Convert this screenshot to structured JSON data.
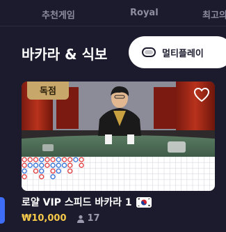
{
  "nav": {
    "items": [
      {
        "label": "추천게임"
      },
      {
        "label": "Royal"
      },
      {
        "label": "최고의"
      }
    ]
  },
  "section": {
    "title": "바카라 & 식보",
    "multi_play_label": "멀티플레이"
  },
  "card": {
    "badge": "독점",
    "name": "로얄 VIP 스피드 바카라 1",
    "price": "₩10,000",
    "players": "17",
    "flag": "kr-flag",
    "favorite_icon": "heart-icon"
  },
  "colors": {
    "background": "#1c1b2d",
    "badge": "#c8a86a",
    "price": "#f5c84a",
    "banker": "#e23b3b",
    "player": "#2f6fd6"
  }
}
